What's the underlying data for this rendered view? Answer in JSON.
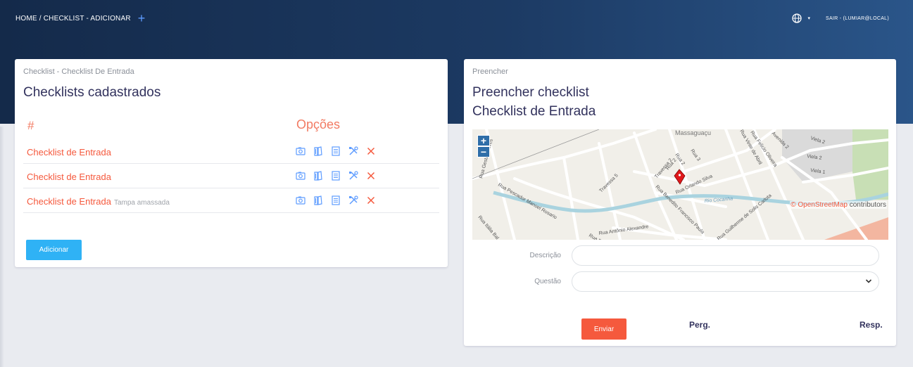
{
  "header": {
    "breadcrumb": "HOME / CHECKLIST - ADICIONAR",
    "add_symbol": "+",
    "language_caret": "▾",
    "logout_label": "SAIR - (LUMIAR@LOCAL)"
  },
  "list_card": {
    "subtitle": "Checklist - Checklist De Entrada",
    "title": "Checklists cadastrados",
    "columns": {
      "index": "#",
      "options": "Opções"
    },
    "rows": [
      {
        "name": "Checklist de Entrada",
        "note": ""
      },
      {
        "name": "Checklist de Entrada",
        "note": ""
      },
      {
        "name": "Checklist de Entrada",
        "note": "Tampa amassada"
      }
    ],
    "row_icons": [
      "camera-icon",
      "book-icon",
      "document-icon",
      "tools-icon",
      "close-icon"
    ],
    "add_button": "Adicionar"
  },
  "fill_card": {
    "subtitle": "Preencher",
    "title_line1": "Preencher checklist",
    "title_line2": "Checklist de Entrada",
    "map": {
      "zoom_in": "+",
      "zoom_out": "−",
      "attribution_link": "© OpenStreetMap",
      "attribution_rest": " contributors",
      "labels": {
        "massaguacu": "Massaguaçu",
        "viela2a": "Viela 2",
        "viela2b": "Viela 2",
        "viela1": "Viela 1",
        "avenida2": "Avenida 2",
        "felicio": "Rua Felicio Oliveira",
        "vinte": "Rua Vinte de Abril",
        "rua3": "Rua 3",
        "rua2a": "Rua 2",
        "rua2b": "Rua 2",
        "travessa2": "Travessa 2",
        "travessa5": "Travessa 5",
        "orlando": "Rua Orlando Silva",
        "benedito": "Rua Benedito Francisco Paula",
        "rio": "Rio Cocanha",
        "pescador": "Rua Pescador Manoel Rosario",
        "gestalo": "Rua Gestalo Alves",
        "antonio": "Rua Antônio Alexandre",
        "italia": "Rua Itália Bal",
        "rua_pe": "Rua Pe",
        "guilherme": "Rua Guilherme de Solis Carlota"
      }
    },
    "form": {
      "descricao_label": "Descrição",
      "descricao_value": "",
      "questao_label": "Questão",
      "questao_selected": ""
    },
    "send_button": "Enviar",
    "col_question": "Perg.",
    "col_answer": "Resp."
  },
  "colors": {
    "header_dark": "#142a4a",
    "accent_red": "#f5593d",
    "accent_blue": "#2fb2f5",
    "icon_blue": "#5e9cff"
  }
}
